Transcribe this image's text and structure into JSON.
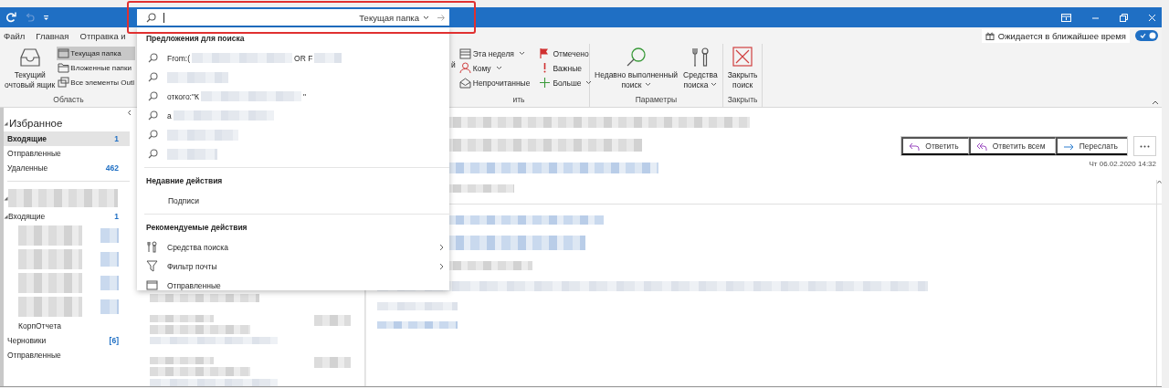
{
  "title_bar": {
    "search": {
      "scope": "Текущая папка"
    }
  },
  "ribbon": {
    "tabs": [
      {
        "label": "Файл",
        "selected": false
      },
      {
        "label": "Главная",
        "selected": false
      },
      {
        "label": "Отправка и",
        "selected": false
      }
    ],
    "notice": {
      "label": "Ожидается в ближайшее время",
      "on": true
    },
    "groups": [
      {
        "label": "Область",
        "items": [
          {
            "kind": "large",
            "lines": [
              "Текущий",
              "очтовый ящик"
            ],
            "dropdown": false
          },
          {
            "kind": "small",
            "label": "Текущая папка",
            "selected": true,
            "dropdown": false
          },
          {
            "kind": "small",
            "label": "Вложенные папки",
            "selected": false,
            "dropdown": false
          },
          {
            "kind": "small",
            "label": "Все элементы Outl",
            "selected": false,
            "dropdown": false
          }
        ]
      },
      {
        "label": "ить",
        "items": [
          {
            "kind": "fragment",
            "label": "й"
          },
          {
            "kind": "small",
            "label": "Эта неделя",
            "selected": false,
            "dropdown": true
          },
          {
            "kind": "small",
            "label": "Кому",
            "selected": false,
            "dropdown": true
          },
          {
            "kind": "small",
            "label": "Непрочитанные",
            "selected": false,
            "dropdown": false
          },
          {
            "kind": "small",
            "label": "Отмечено",
            "selected": false,
            "dropdown": false
          },
          {
            "kind": "small",
            "label": "Важные",
            "selected": false,
            "dropdown": false
          },
          {
            "kind": "small",
            "label": "Больше",
            "selected": false,
            "dropdown": true
          }
        ]
      },
      {
        "label": "Параметры",
        "items": [
          {
            "kind": "large",
            "lines": [
              "Недавно выполненный",
              "поиск"
            ],
            "dropdown": true
          },
          {
            "kind": "large",
            "lines": [
              "Средства",
              "поиска"
            ],
            "dropdown": true
          }
        ]
      },
      {
        "label": "Закрыть",
        "items": [
          {
            "kind": "large",
            "lines": [
              "Закрыть",
              "поиск"
            ],
            "dropdown": false
          }
        ]
      }
    ]
  },
  "search_dropdown": {
    "sections": [
      {
        "title": "Предложения для поиска",
        "kind": "suggestions",
        "items": [
          {
            "parts": [
              {
                "kind": "text",
                "text": "From:("
              },
              {
                "kind": "blur"
              },
              {
                "kind": "text",
                "text": "OR F"
              },
              {
                "kind": "blur"
              }
            ]
          },
          {
            "parts": [
              {
                "kind": "blur"
              }
            ]
          },
          {
            "parts": [
              {
                "kind": "text",
                "text": "откого:\"К"
              },
              {
                "kind": "blur"
              },
              {
                "kind": "text",
                "text": "\""
              }
            ]
          },
          {
            "parts": [
              {
                "kind": "text",
                "text": "а"
              },
              {
                "kind": "blur"
              }
            ]
          },
          {
            "parts": [
              {
                "kind": "blur"
              }
            ]
          },
          {
            "parts": [
              {
                "kind": "blur"
              }
            ]
          }
        ]
      },
      {
        "title": "Недавние действия",
        "kind": "recent",
        "items": [
          {
            "label": "Подписи",
            "submenu": false
          }
        ]
      },
      {
        "title": "Рекомендуемые действия",
        "kind": "actions",
        "items": [
          {
            "label": "Средства поиска",
            "submenu": true
          },
          {
            "label": "Фильтр почты",
            "submenu": true
          },
          {
            "label": "Отправленные",
            "submenu": false
          }
        ]
      }
    ]
  },
  "navigation": {
    "favorites": {
      "title": "Избранное",
      "expanded": true,
      "items": [
        {
          "label": "Входящие",
          "count": "1",
          "selected": true
        },
        {
          "label": "Отправленные",
          "selected": false
        },
        {
          "label": "Удаленные",
          "count": "462",
          "selected": false
        }
      ]
    },
    "account": {
      "expanded": true,
      "folders": [
        {
          "kind": "folder",
          "label": "Входящие",
          "count": "1",
          "expanded": true,
          "children": [
            {
              "kind": "blurred"
            },
            {
              "kind": "blurred"
            },
            {
              "kind": "blurred"
            },
            {
              "kind": "blurred"
            },
            {
              "kind": "folder",
              "label": "КорпОтчета"
            }
          ]
        },
        {
          "kind": "folder",
          "label": "Черновики",
          "count": "[6]"
        },
        {
          "kind": "folder",
          "label": "Отправленные"
        }
      ]
    }
  },
  "reading_pane": {
    "actions": [
      {
        "label": "Ответить"
      },
      {
        "label": "Ответить всем"
      },
      {
        "label": "Переслать"
      }
    ],
    "date": "Чт 06.02.2020 14:32"
  }
}
